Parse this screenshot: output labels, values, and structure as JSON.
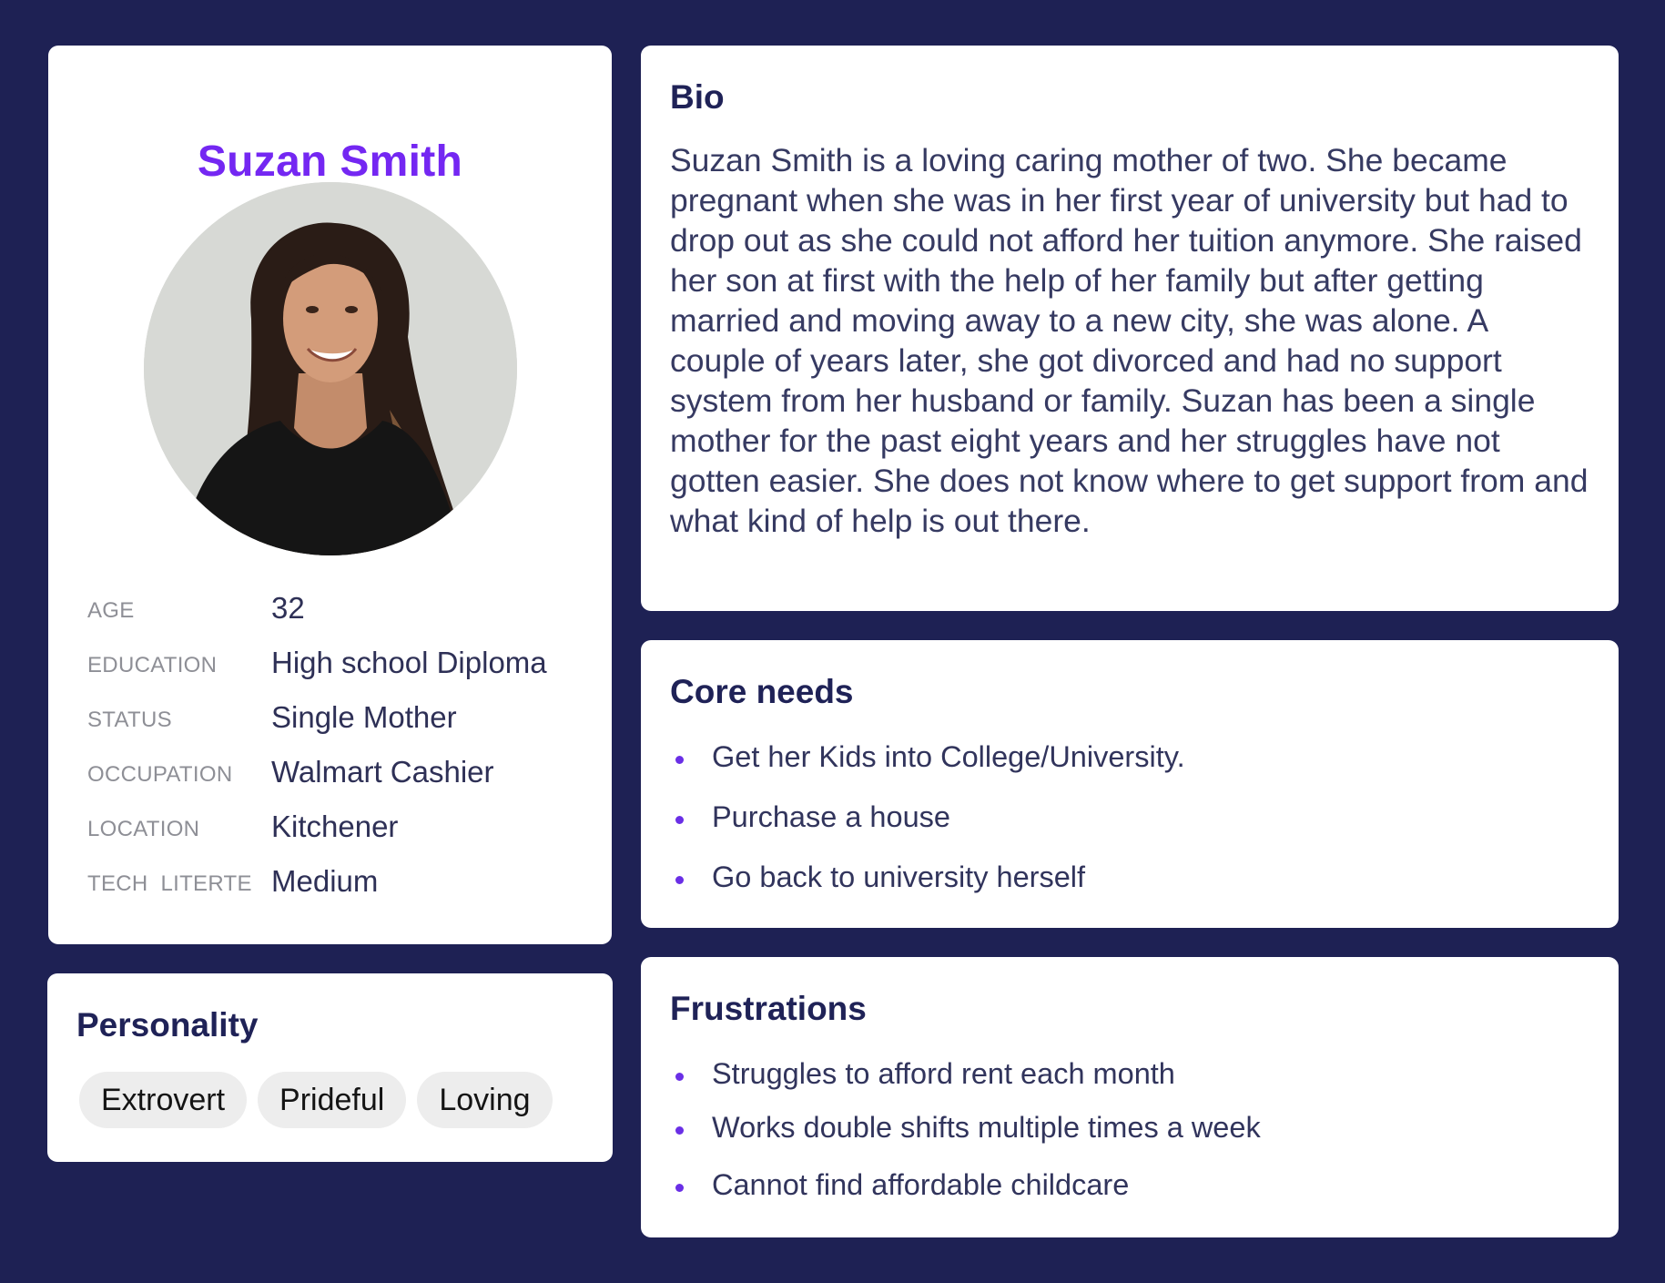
{
  "profile": {
    "name": "Suzan Smith",
    "details": [
      {
        "label": "AGE",
        "value": "32"
      },
      {
        "label": "EDUCATION",
        "value": "High school Diploma"
      },
      {
        "label": "STATUS",
        "value": "Single Mother"
      },
      {
        "label": "OCCUPATION",
        "value": "Walmart Cashier"
      },
      {
        "label": "LOCATION",
        "value": "Kitchener"
      },
      {
        "label": "TECH  LITERTE",
        "value": "Medium"
      }
    ]
  },
  "personality": {
    "title": "Personality",
    "tags": [
      "Extrovert",
      "Prideful",
      "Loving"
    ]
  },
  "bio": {
    "title": "Bio",
    "text": "Suzan Smith is a loving caring mother of two. She became pregnant when she was in her first year of university but had to drop out as she could not afford her tuition anymore. She raised her son at first with the help of her family but after getting married and moving away to a new city, she was alone. A couple of years later, she got divorced and had no support system from her husband or family. Suzan has been a single mother for the past eight years and her struggles have not gotten easier. She does not know where to get support from and what kind of help is out there."
  },
  "core_needs": {
    "title": "Core needs",
    "items": [
      "Get her Kids into College/University.",
      "Purchase a house",
      "Go back to university herself"
    ]
  },
  "frustrations": {
    "title": "Frustrations",
    "items": [
      "Struggles to afford rent each month",
      "Works double shifts multiple times a week",
      "Cannot find affordable childcare"
    ]
  },
  "colors": {
    "background": "#1e2154",
    "accent": "#7427f2",
    "heading": "#1f2257",
    "card": "#ffffff"
  }
}
